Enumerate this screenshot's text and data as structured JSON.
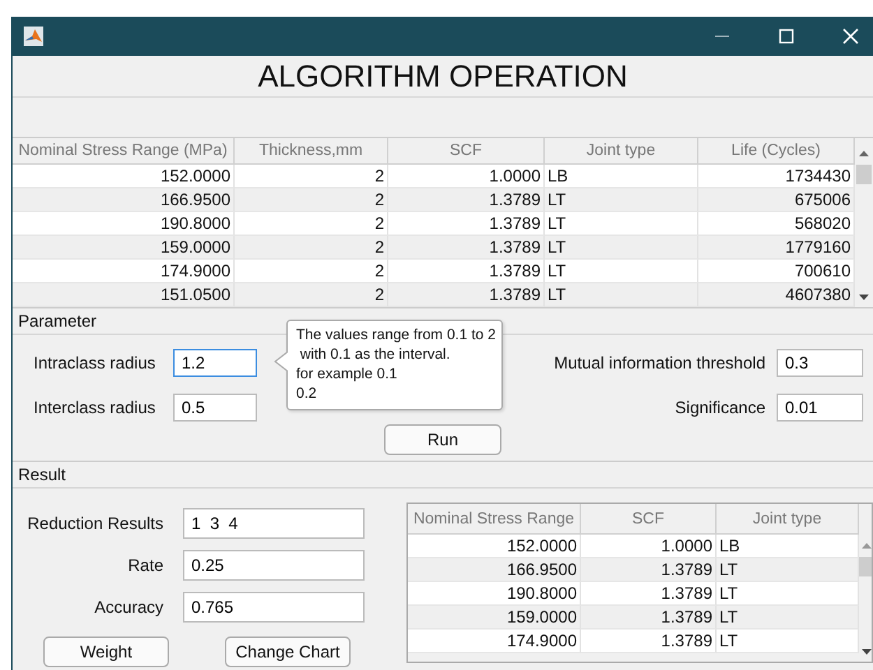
{
  "window": {
    "heading": "ALGORITHM OPERATION"
  },
  "table": {
    "columns": [
      "Nominal Stress Range (MPa)",
      "Thickness,mm",
      "SCF",
      "Joint type",
      "Life (Cycles)"
    ],
    "rows": [
      [
        "152.0000",
        "2",
        "1.0000",
        "LB",
        "1734430"
      ],
      [
        "166.9500",
        "2",
        "1.3789",
        "LT",
        "675006"
      ],
      [
        "190.8000",
        "2",
        "1.3789",
        "LT",
        "568020"
      ],
      [
        "159.0000",
        "2",
        "1.3789",
        "LT",
        "1779160"
      ],
      [
        "174.9000",
        "2",
        "1.3789",
        "LT",
        "700610"
      ],
      [
        "151.0500",
        "2",
        "1.3789",
        "LT",
        "4607380"
      ]
    ]
  },
  "parameter": {
    "title": "Parameter",
    "fields": [
      {
        "label": "Intraclass radius",
        "value": "1.2",
        "focused": true
      },
      {
        "label": "Mutual information threshold",
        "value": "0.3",
        "focused": false
      },
      {
        "label": "Interclass radius",
        "value": "0.5",
        "focused": false
      },
      {
        "label": "Significance",
        "value": "0.01",
        "focused": false
      }
    ],
    "tooltip": {
      "lines": [
        "The values range from 0.1 to 2",
        " with 0.1 as the interval.",
        "for example 0.1",
        "0.2"
      ]
    },
    "run_button": "Run"
  },
  "result": {
    "title": "Result",
    "fields": [
      {
        "label": "Reduction Results",
        "value": "1  3  4"
      },
      {
        "label": "Rate",
        "value": "0.25"
      },
      {
        "label": "Accuracy",
        "value": "0.765"
      }
    ],
    "buttons": [
      "Weight",
      "Change Chart"
    ],
    "table": {
      "columns": [
        "Nominal Stress Range",
        "SCF",
        "Joint type"
      ],
      "rows": [
        [
          "152.0000",
          "1.0000",
          "LB"
        ],
        [
          "166.9500",
          "1.3789",
          "LT"
        ],
        [
          "190.8000",
          "1.3789",
          "LT"
        ],
        [
          "159.0000",
          "1.3789",
          "LT"
        ],
        [
          "174.9000",
          "1.3789",
          "LT"
        ]
      ]
    }
  }
}
